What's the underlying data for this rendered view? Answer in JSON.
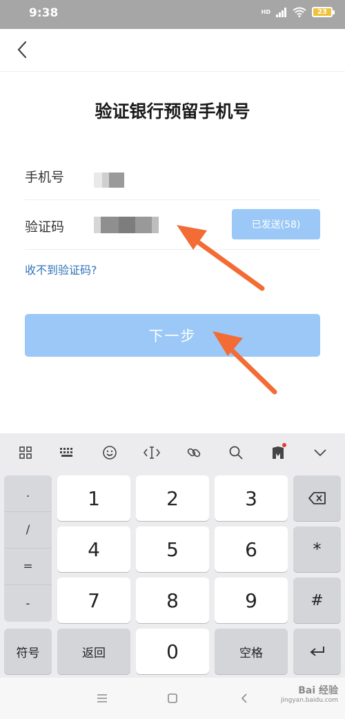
{
  "status_bar": {
    "time": "9:38",
    "signal_label": "HD",
    "battery_level": "23"
  },
  "page": {
    "title": "验证银行预留手机号"
  },
  "form": {
    "phone_label": "手机号",
    "code_label": "验证码",
    "send_button_label": "已发送(58)"
  },
  "links": {
    "no_code": "收不到验证码?"
  },
  "next_button_label": "下一步",
  "keyboard": {
    "symbols": [
      ".",
      "/",
      "=",
      "-"
    ],
    "digits": [
      "1",
      "2",
      "3",
      "4",
      "5",
      "6",
      "7",
      "8",
      "9",
      "0"
    ],
    "symbol_key": "符号",
    "back_key": "返回",
    "space_key": "空格",
    "star_key": "*",
    "hash_key": "#",
    "toolbar_icons": [
      "grid-icon",
      "keyboard-icon",
      "emoji-icon",
      "cursor-icon",
      "link-icon",
      "search-icon",
      "app-icon",
      "collapse-icon"
    ]
  },
  "watermark": {
    "main": "Bai 经验",
    "sub": "jingyan.baidu.com"
  },
  "colors": {
    "accent_disabled": "#9bc8f7",
    "link": "#2f73b8",
    "annotation_arrow": "#f36b35"
  }
}
